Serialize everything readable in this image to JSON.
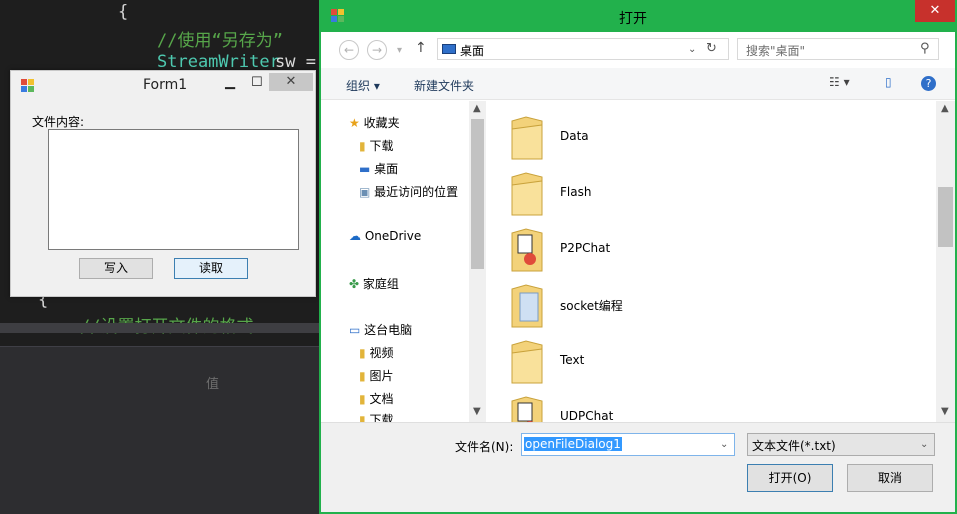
{
  "editor": {
    "lines": [
      "{",
      "//使用“另存为”",
      "StreamWriter",
      " sw =",
      "{",
      "//设置打开文件的格式"
    ],
    "panel_label": "值"
  },
  "form1": {
    "title": "Form1",
    "minimize": "▁",
    "maximize": "☐",
    "close": "✕",
    "content_label": "文件内容:",
    "textbox_value": "",
    "write_button": "写入",
    "read_button": "读取"
  },
  "dialog": {
    "title": "打开",
    "close": "✕",
    "address": "桌面",
    "search_placeholder": "搜索\"桌面\"",
    "toolbar": {
      "organize": "组织 ▾",
      "new_folder": "新建文件夹"
    },
    "tree": [
      {
        "label": "收藏夹"
      },
      {
        "label": "下载"
      },
      {
        "label": "桌面"
      },
      {
        "label": "最近访问的位置"
      },
      {
        "label": "OneDrive"
      },
      {
        "label": "家庭组"
      },
      {
        "label": "这台电脑"
      },
      {
        "label": "视频"
      },
      {
        "label": "图片"
      },
      {
        "label": "文档"
      },
      {
        "label": "下载"
      }
    ],
    "files": [
      {
        "name": "Data"
      },
      {
        "name": "Flash"
      },
      {
        "name": "P2PChat"
      },
      {
        "name": "socket编程"
      },
      {
        "name": "Text"
      },
      {
        "name": "UDPChat"
      }
    ],
    "filename_label": "文件名(N):",
    "filename_value": "openFileDialog1",
    "filetype_value": "文本文件(*.txt)",
    "open_button": "打开(O)",
    "cancel_button": "取消"
  },
  "colors": {
    "dialog_frame": "#22b14c",
    "selection": "#3399ff",
    "close": "#c7312c"
  }
}
